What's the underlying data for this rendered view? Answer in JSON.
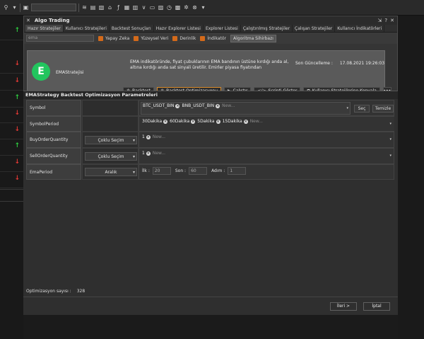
{
  "toolbar": {
    "icons": [
      "search-icon",
      "chevron-down-icon",
      "save-icon",
      "layers-icon",
      "chart-icon",
      "document-icon",
      "bank-icon",
      "function-icon",
      "news-icon",
      "calculator-icon",
      "display-icon",
      "image-icon",
      "alarm-icon",
      "calendar-icon",
      "gear-icon",
      "close-icon"
    ]
  },
  "left_arrows": [
    "up",
    "down",
    "down",
    "up",
    "down",
    "down",
    "up",
    "down",
    "down"
  ],
  "window": {
    "title": "Algo Trading",
    "tabs": [
      "Hazır Stratejiler",
      "Kullanıcı Stratejileri",
      "Backtest Sonuçları",
      "Hazır Explorer Listesi",
      "Explorer Listesi",
      "Çalıştırılmış Stratejiler",
      "Çalışan Stratejiler",
      "Kullanıcı İndikatörleri"
    ],
    "search_placeholder": "ema",
    "filters": [
      "Yapay Zeka",
      "Yüzeysel Veri",
      "Derinlik",
      "İndikatör"
    ],
    "wizard_button": "Algoritma Sihirbazı"
  },
  "strategy": {
    "logo_letter": "E",
    "name": "EMAStratejisi",
    "description": "EMA indikatöründe, fiyat çubuklarının EMA bandının üstüne kırdığı anda al, altına kırdığı anda sat sinyali üretilir. Emirler piyasa fiyatından",
    "updated_label": "Son Güncelleme :",
    "updated_value": "17.08.2021 19:26:03",
    "buttons": [
      "Backtest",
      "Backtest Optimizasyonu",
      "Çalıştır",
      "Scripti Göster",
      "Kullanıcı Stratejilerine Kopyala"
    ]
  },
  "dialog": {
    "title": "EMAStrategy Backtest Optimizasyon Parametreleri",
    "params": [
      {
        "label": "Symbol",
        "mode": "",
        "tags": [
          "BTC_USDT_BIN",
          "BNB_USDT_BIN"
        ],
        "placeholder": "New..."
      },
      {
        "label": "SymbolPeriod",
        "mode": "",
        "tags": [
          "30Dakika",
          "60Dakika",
          "5Dakika",
          "15Dakika"
        ],
        "placeholder": "New..."
      },
      {
        "label": "BuyOrderQuantity",
        "mode": "Çoklu Seçim",
        "tags": [
          "1"
        ],
        "placeholder": "New..."
      },
      {
        "label": "SellOrderQuantity",
        "mode": "Çoklu Seçim",
        "tags": [
          "1"
        ],
        "placeholder": "New..."
      },
      {
        "label": "EmaPeriod",
        "mode": "Aralık",
        "tags": [],
        "placeholder": ""
      }
    ],
    "range": {
      "start_label": "İlk :",
      "start": "20",
      "end_label": "Son :",
      "end": "60",
      "step_label": "Adım :",
      "step": "1"
    },
    "select_button": "Seç",
    "clear_button": "Temizle",
    "count_label": "Optimizasyon sayısı :",
    "count_value": "328",
    "next_button": "İleri >",
    "cancel_button": "İptal"
  }
}
